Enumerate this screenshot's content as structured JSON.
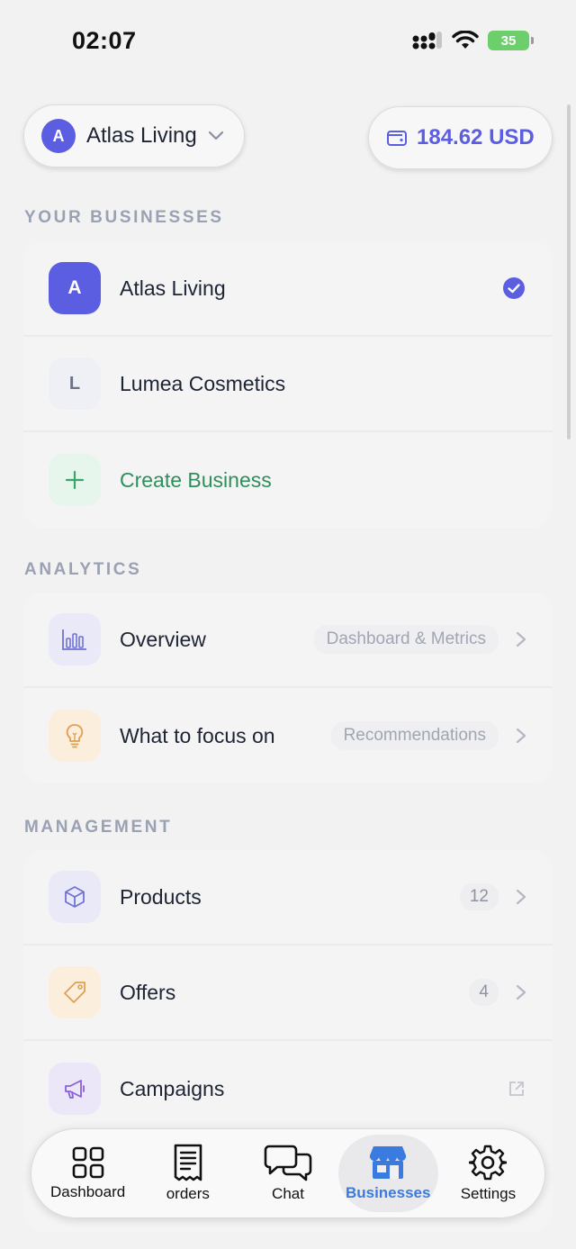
{
  "status_bar": {
    "time": "02:07",
    "battery": "35"
  },
  "header": {
    "business_selector": {
      "initial": "A",
      "name": "Atlas Living"
    },
    "wallet": {
      "amount": "184.62 USD"
    }
  },
  "sections": {
    "businesses": {
      "title": "YOUR BUSINESSES",
      "items": [
        {
          "initial": "A",
          "name": "Atlas Living",
          "selected": true
        },
        {
          "initial": "L",
          "name": "Lumea Cosmetics",
          "selected": false
        }
      ],
      "create_label": "Create Business"
    },
    "analytics": {
      "title": "ANALYTICS",
      "items": [
        {
          "label": "Overview",
          "meta": "Dashboard & Metrics",
          "icon": "bar-chart-icon"
        },
        {
          "label": "What to focus on",
          "meta": "Recommendations",
          "icon": "lightbulb-icon"
        }
      ]
    },
    "management": {
      "title": "MANAGEMENT",
      "items": [
        {
          "label": "Products",
          "count": "12",
          "icon": "cube-icon"
        },
        {
          "label": "Offers",
          "count": "4",
          "icon": "tag-icon"
        },
        {
          "label": "Campaigns",
          "icon": "megaphone-icon"
        }
      ]
    }
  },
  "tabs": [
    {
      "label": "Dashboard",
      "icon": "grid-icon"
    },
    {
      "label": "orders",
      "icon": "receipt-icon"
    },
    {
      "label": "Chat",
      "icon": "chat-bubbles-icon"
    },
    {
      "label": "Businesses",
      "icon": "storefront-icon",
      "active": true
    },
    {
      "label": "Settings",
      "icon": "gear-icon"
    }
  ],
  "colors": {
    "accent": "#5b5ee0",
    "create_green": "#2f8f5b",
    "tab_active": "#3a7be0",
    "background": "#f2f2f3"
  }
}
